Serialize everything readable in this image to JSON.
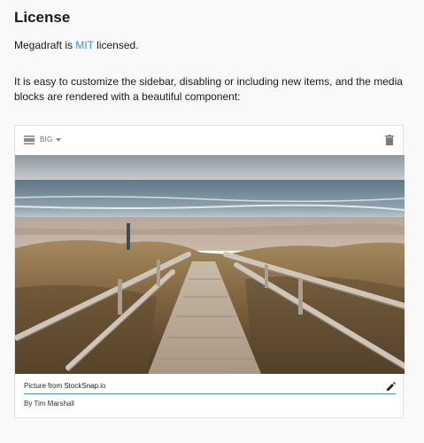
{
  "section": {
    "heading": "License",
    "license_prefix": "Megadraft is ",
    "license_link": "MIT",
    "license_suffix": " licensed.",
    "description": "It is easy to customize the sidebar, disabling or including new items, and the media blocks are rendered with a beautiful component:"
  },
  "media_block": {
    "size_option": "BIG",
    "caption": "Picture from StockSnap.io",
    "credit": "By Tim Marshall",
    "icons": {
      "size": "image-size-icon",
      "dropdown": "chevron-down-icon",
      "delete": "trash-icon",
      "edit": "pencil-icon"
    }
  },
  "colors": {
    "link": "#3a8fd4",
    "caption_underline": "#4a90d9",
    "background": "#f9f9f9"
  }
}
